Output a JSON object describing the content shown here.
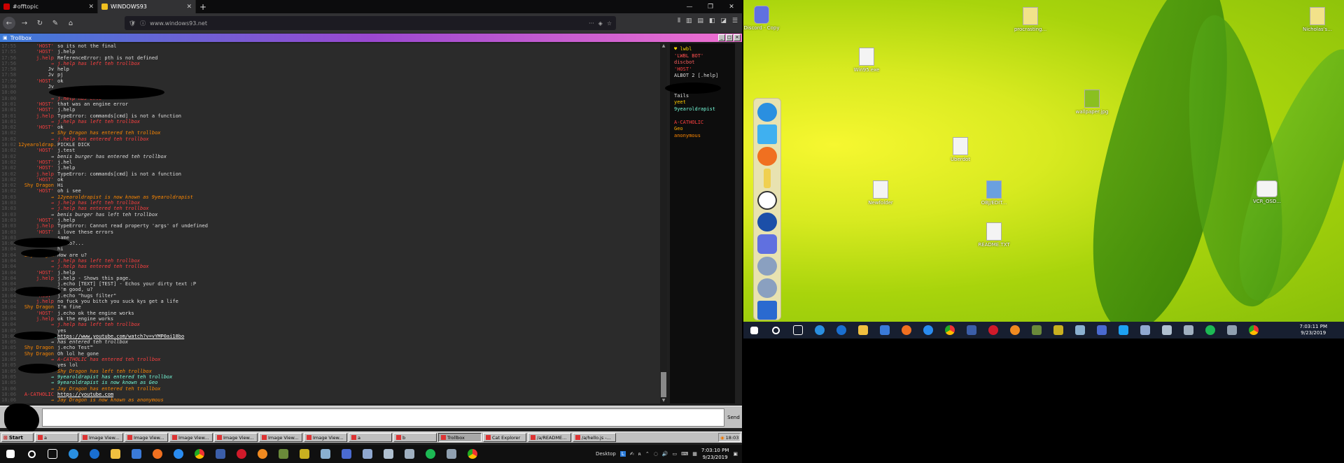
{
  "browser": {
    "tabs": [
      {
        "title": "#offtopic",
        "active": false
      },
      {
        "title": "WINDOWS93",
        "active": true
      }
    ],
    "url": "www.windows93.net"
  },
  "trollbox": {
    "title": "Trollbox",
    "messages": [
      {
        "time": "17:55",
        "nick": "'HOST'",
        "color": "#f43f3f",
        "msg": "so its not the final"
      },
      {
        "time": "17:55",
        "nick": "'HOST'",
        "color": "#f43f3f",
        "msg": "j.help"
      },
      {
        "time": "17:56",
        "nick": "j.help",
        "color": "#f43f3f",
        "msg": "ReferenceError: pth is not defined"
      },
      {
        "time": "17:56",
        "nick": "→",
        "color": "#ff4040",
        "msg": "j.help has left teh trollbox",
        "sys": true
      },
      {
        "time": "17:58",
        "nick": "Jv",
        "color": "#ddd",
        "msg": "help"
      },
      {
        "time": "17:58",
        "nick": "Jv",
        "color": "#ddd",
        "msg": "pj"
      },
      {
        "time": "17:59",
        "nick": "'HOST'",
        "color": "#f43f3f",
        "msg": "ok"
      },
      {
        "time": "18:00",
        "nick": "Jv",
        "color": "#ddd",
        "msg": ""
      },
      {
        "time": "18:00",
        "nick": "",
        "color": "#ddd",
        "msg": ""
      },
      {
        "time": "18:00",
        "nick": "→",
        "color": "#ff4040",
        "msg": "j.help has ente",
        "sys": true
      },
      {
        "time": "18:01",
        "nick": "'HOST'",
        "color": "#f43f3f",
        "msg": "that was an engine error"
      },
      {
        "time": "18:01",
        "nick": "'HOST'",
        "color": "#f43f3f",
        "msg": "j.help"
      },
      {
        "time": "18:01",
        "nick": "j.help",
        "color": "#f43f3f",
        "msg": "TypeError: commands[cmd] is not a function"
      },
      {
        "time": "18:01",
        "nick": "→",
        "color": "#ff4040",
        "msg": "j.help has left teh trollbox",
        "sys": true
      },
      {
        "time": "18:02",
        "nick": "'HOST'",
        "color": "#f43f3f",
        "msg": "ok"
      },
      {
        "time": "18:02",
        "nick": "→",
        "color": "#ff8800",
        "msg": "Shy Dragon has entered teh trollbox",
        "sys": true
      },
      {
        "time": "18:02",
        "nick": "→",
        "color": "#ff4040",
        "msg": "j.help has entered teh trollbox",
        "sys": true
      },
      {
        "time": "18:02",
        "nick": "12yearoldrap..",
        "color": "#ff8800",
        "msg": "PICKLE DICK"
      },
      {
        "time": "18:02",
        "nick": "'HOST'",
        "color": "#f43f3f",
        "msg": "j.test"
      },
      {
        "time": "18:02",
        "nick": "→",
        "color": "#ddd",
        "msg": "benis burger has entered teh trollbox",
        "sys": true
      },
      {
        "time": "18:02",
        "nick": "'HOST'",
        "color": "#f43f3f",
        "msg": "j.hel"
      },
      {
        "time": "18:02",
        "nick": "'HOST'",
        "color": "#f43f3f",
        "msg": "j.help"
      },
      {
        "time": "18:02",
        "nick": "j.help",
        "color": "#f43f3f",
        "msg": "TypeError: commands[cmd] is not a function"
      },
      {
        "time": "18:02",
        "nick": "'HOST'",
        "color": "#f43f3f",
        "msg": "ok"
      },
      {
        "time": "18:02",
        "nick": "Shy Dragon",
        "color": "#ff8800",
        "msg": "Hi"
      },
      {
        "time": "18:02",
        "nick": "'HOST'",
        "color": "#f43f3f",
        "msg": "oh i see"
      },
      {
        "time": "18:03",
        "nick": "→",
        "color": "#ff8800",
        "msg": "12yearoldrapist is now known as 9yearoldrapist",
        "sys": true
      },
      {
        "time": "18:03",
        "nick": "→",
        "color": "#ff4040",
        "msg": "j.help has left teh trollbox",
        "sys": true
      },
      {
        "time": "18:03",
        "nick": "→",
        "color": "#ff4040",
        "msg": "j.help has entered teh trollbox",
        "sys": true
      },
      {
        "time": "18:03",
        "nick": "→",
        "color": "#ddd",
        "msg": "benis burger has left teh trollbox",
        "sys": true
      },
      {
        "time": "18:03",
        "nick": "'HOST'",
        "color": "#f43f3f",
        "msg": "j.help"
      },
      {
        "time": "18:03",
        "nick": "j.help",
        "color": "#f43f3f",
        "msg": "TypeError: Cannot read property 'args' of undefined"
      },
      {
        "time": "18:03",
        "nick": "'HOST'",
        "color": "#f43f3f",
        "msg": "i love these errors"
      },
      {
        "time": "18:03",
        "nick": "",
        "color": "#ddd",
        "msg": "same"
      },
      {
        "time": "18:03",
        "nick": "Shy Dragon",
        "color": "#ff8800",
        "msg": "Hello?..."
      },
      {
        "time": "18:04",
        "nick": "",
        "color": "#ddd",
        "msg": "hi"
      },
      {
        "time": "18:04",
        "nick": "Shy Dragon",
        "color": "#ff8800",
        "msg": "How are u?"
      },
      {
        "time": "18:04",
        "nick": "→",
        "color": "#ff4040",
        "msg": "j.help has left teh trollbox",
        "sys": true
      },
      {
        "time": "18:04",
        "nick": "→",
        "color": "#ff4040",
        "msg": "j.help has entered teh trollbox",
        "sys": true
      },
      {
        "time": "18:04",
        "nick": "'HOST'",
        "color": "#f43f3f",
        "msg": "j.help"
      },
      {
        "time": "18:04",
        "nick": "j.help",
        "color": "#f43f3f",
        "msg": "j.help - Shows this page."
      },
      {
        "time": "18:04",
        "nick": "",
        "color": "#ddd",
        "msg": "j.echo [TEXT] [TEST] - Echos your dirty text :P"
      },
      {
        "time": "18:04",
        "nick": "",
        "color": "#ddd",
        "msg": "i'm good, u?"
      },
      {
        "time": "18:04",
        "nick": "'HOST'",
        "color": "#f43f3f",
        "msg": "j.echo \"hugs filter\""
      },
      {
        "time": "18:04",
        "nick": "j.help",
        "color": "#f43f3f",
        "msg": "no fuck you bitch you suck kys get a life"
      },
      {
        "time": "18:04",
        "nick": "Shy Dragon",
        "color": "#ff8800",
        "msg": "I'm fine"
      },
      {
        "time": "18:04",
        "nick": "'HOST'",
        "color": "#f43f3f",
        "msg": "j.echo ok the engine works"
      },
      {
        "time": "18:04",
        "nick": "j.help",
        "color": "#f43f3f",
        "msg": "ok the engine works"
      },
      {
        "time": "18:04",
        "nick": "→",
        "color": "#ff4040",
        "msg": "j.help has left teh trollbox",
        "sys": true
      },
      {
        "time": "18:05",
        "nick": "",
        "color": "#ddd",
        "msg": "yes"
      },
      {
        "time": "18:05",
        "nick": "9yearoldrapis..",
        "color": "#7fd",
        "msg": "https://www.youtube.com/watch?v=vYMP0ai18bo",
        "link": true
      },
      {
        "time": "18:05",
        "nick": "→",
        "color": "#ddd",
        "msg": "has entered teh trollbox",
        "sys": true
      },
      {
        "time": "18:05",
        "nick": "Shy Dragon",
        "color": "#ff8800",
        "msg": "j.echo Test™"
      },
      {
        "time": "18:05",
        "nick": "Shy Dragon",
        "color": "#ff8800",
        "msg": "Oh lol he gone"
      },
      {
        "time": "18:05",
        "nick": "→",
        "color": "#ff4040",
        "msg": "A-CATHOLIC has entered teh trollbox",
        "sys": true
      },
      {
        "time": "18:05",
        "nick": "",
        "color": "#ddd",
        "msg": "yes lol"
      },
      {
        "time": "18:05",
        "nick": "→",
        "color": "#ff8800",
        "msg": "Shy Dragon has left teh trollbox",
        "sys": true
      },
      {
        "time": "18:05",
        "nick": "→",
        "color": "#7fd",
        "msg": "9yearoldrapist has entered teh trollbox",
        "sys": true
      },
      {
        "time": "18:05",
        "nick": "→",
        "color": "#7fd",
        "msg": "9yearoldrapist is now known as Geo",
        "sys": true
      },
      {
        "time": "18:06",
        "nick": "→",
        "color": "#ff8800",
        "msg": "Jay Dragon has entered teh trollbox",
        "sys": true
      },
      {
        "time": "18:06",
        "nick": "A-CATHOLIC",
        "color": "#ff4040",
        "msg": "https://youtube.com",
        "link": true
      },
      {
        "time": "18:06",
        "nick": "→",
        "color": "#ff8800",
        "msg": "Jay Dragon is now known as anonymous",
        "sys": true
      }
    ],
    "users": [
      {
        "name": "♥ lwbl",
        "color": "#ffd700"
      },
      {
        "name": "'LWBL BOT'",
        "color": "#ff5050"
      },
      {
        "name": "discbot",
        "color": "#ff6060"
      },
      {
        "name": "'HOST'",
        "color": "#ff4040"
      },
      {
        "name": "ALBOT 2 [.help]",
        "color": "#ddd"
      },
      {
        "name": "",
        "color": "#a050ff"
      },
      {
        "name": "",
        "color": "#ddd"
      },
      {
        "name": "Tails",
        "color": "#ddd"
      },
      {
        "name": "yeet",
        "color": "#ffcc00"
      },
      {
        "name": "9yearoldrapist",
        "color": "#7fd"
      },
      {
        "name": "",
        "color": "#ddd"
      },
      {
        "name": "A-CATHOLIC",
        "color": "#ff4040"
      },
      {
        "name": "Geo",
        "color": "#ffaa00"
      },
      {
        "name": "anonymous",
        "color": "#ff8800"
      }
    ],
    "send_label": "Send",
    "input_value": ""
  },
  "w93_taskbar": {
    "start_label": "Start",
    "tasks": [
      {
        "label": "a",
        "active": false
      },
      {
        "label": "Image View...",
        "active": false
      },
      {
        "label": "Image View...",
        "active": false
      },
      {
        "label": "Image View...",
        "active": false
      },
      {
        "label": "Image View...",
        "active": false
      },
      {
        "label": "Image View...",
        "active": false
      },
      {
        "label": "Image View...",
        "active": false
      },
      {
        "label": "a",
        "active": false
      },
      {
        "label": "b",
        "active": false
      },
      {
        "label": "Trollbox",
        "active": true
      },
      {
        "label": "Cat Explorer",
        "active": false
      },
      {
        "label": "/a/README...",
        "active": false
      },
      {
        "label": "/a/hello.js -...",
        "active": false
      }
    ],
    "clock": "18:03"
  },
  "win_taskbar_left": {
    "desktop_label": "Desktop",
    "time": "7:03:10 PM",
    "date": "9/23/2019"
  },
  "desktop_right": {
    "icons": [
      {
        "label": "Discord - Copy"
      },
      {
        "label": "Win95.exe"
      },
      {
        "label": "procrasting..."
      },
      {
        "label": "Nicholas's..."
      },
      {
        "label": "wallpaper.jpg"
      },
      {
        "label": "Uberdot"
      },
      {
        "label": "Newfolder"
      },
      {
        "label": "OBJ/EDIT..."
      },
      {
        "label": "README.TXT"
      },
      {
        "label": "VCR_OSD..."
      }
    ],
    "taskbar_time": "7:03:11 PM",
    "taskbar_date": "9/23/2019"
  }
}
